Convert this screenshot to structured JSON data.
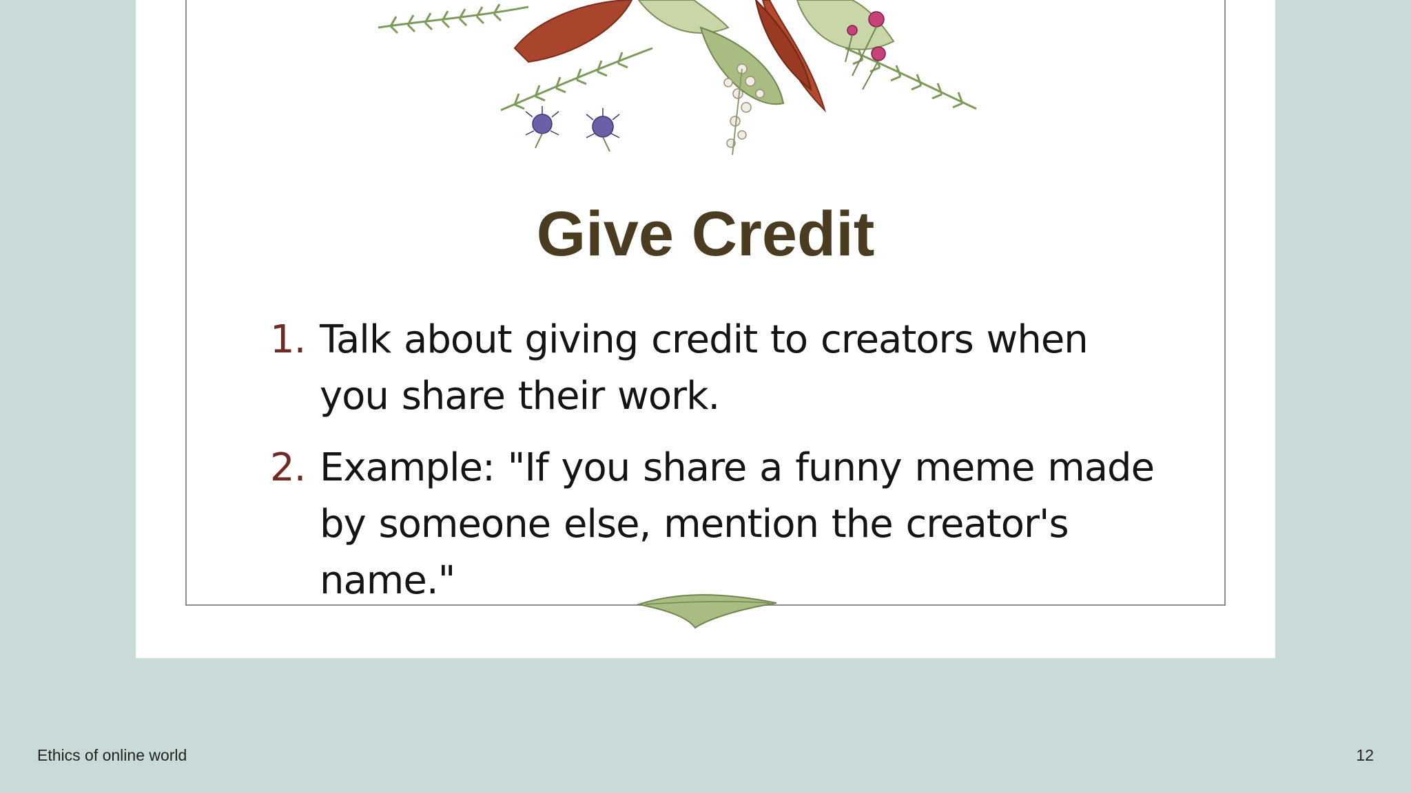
{
  "slide": {
    "title": "Give Credit",
    "items": [
      {
        "number": "1.",
        "text": "Talk about giving credit to creators when you share their work."
      },
      {
        "number": "2.",
        "text": "Example: \"If you share a funny meme made by someone else, mention the creator's name.\""
      }
    ]
  },
  "footer": {
    "presentation_name": "Ethics of online world",
    "page_number": "12"
  },
  "colors": {
    "background": "#c9dbd8",
    "title": "#4a3c20",
    "list_number": "#6e2a24",
    "frame": "#8e8e8a"
  },
  "icons": {
    "top_decoration": "floral-bouquet-icon",
    "bottom_decoration": "leaf-sprig-icon"
  }
}
